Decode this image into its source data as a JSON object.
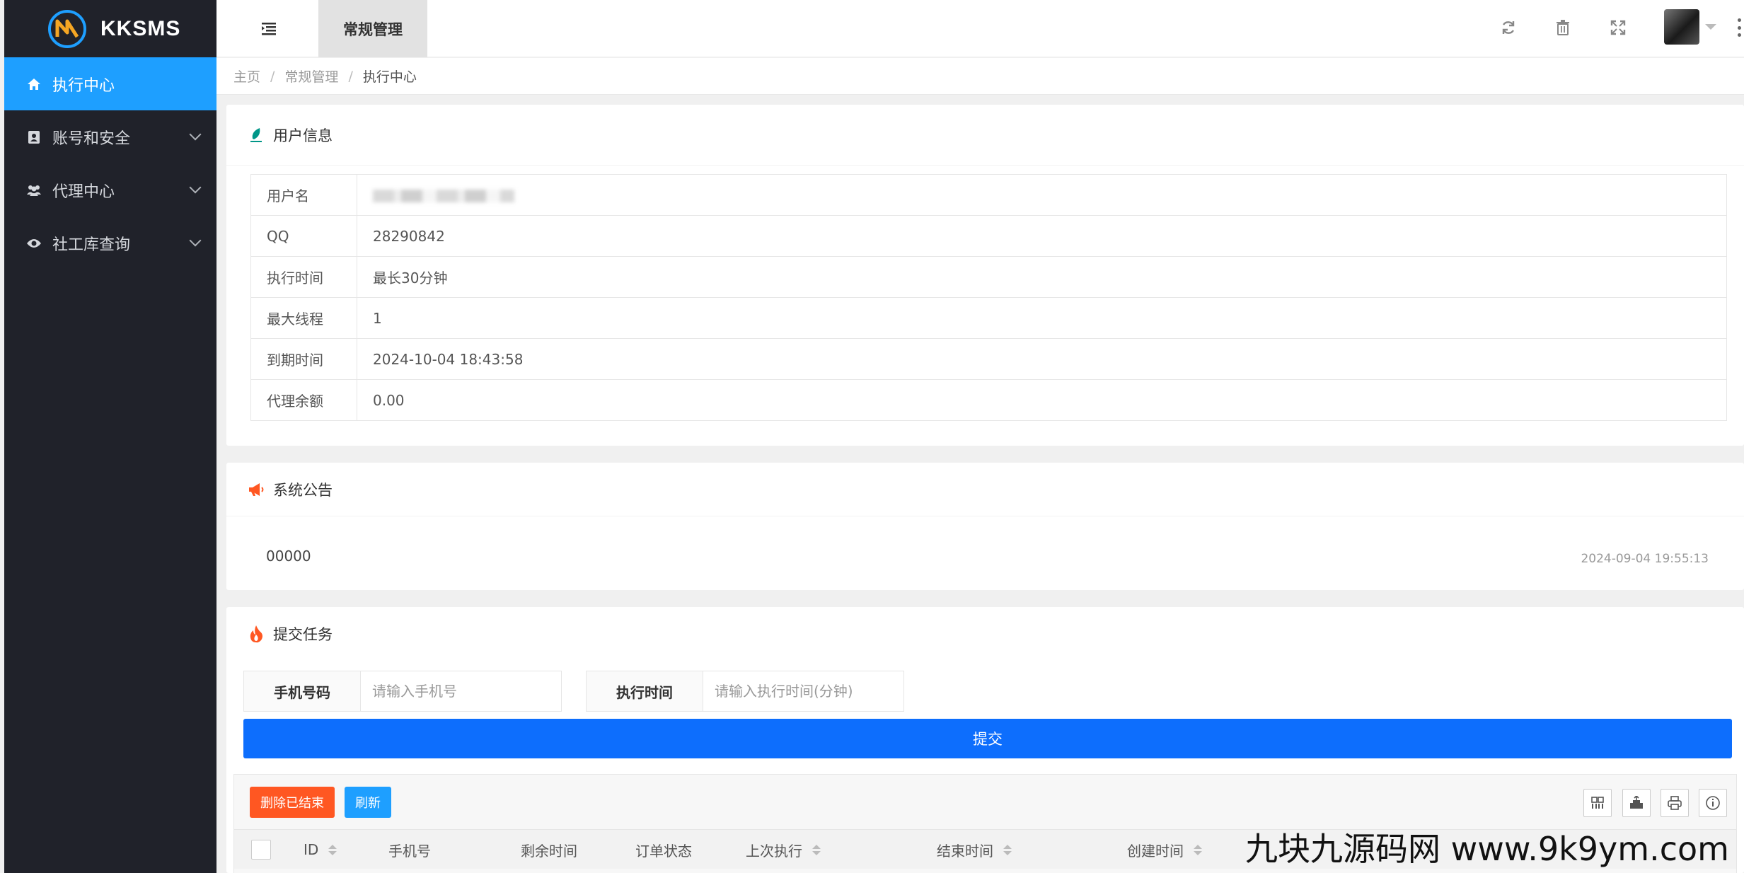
{
  "app": {
    "logo_text": "KKSMS"
  },
  "sidebar": {
    "items": [
      {
        "label": "执行中心",
        "icon": "home-icon",
        "active": true
      },
      {
        "label": "账号和安全",
        "icon": "address-book-icon"
      },
      {
        "label": "代理中心",
        "icon": "users-icon"
      },
      {
        "label": "社工库查询",
        "icon": "eye-icon"
      }
    ]
  },
  "header": {
    "active_tab": "常规管理",
    "icons": [
      "menu-icon",
      "refresh-icon",
      "trash-icon",
      "fullscreen-icon",
      "avatar",
      "more-icon"
    ]
  },
  "breadcrumb": {
    "items": [
      "主页",
      "常规管理",
      "执行中心"
    ]
  },
  "user_info": {
    "title": "用户信息",
    "rows": [
      {
        "key": "用户名",
        "value": ""
      },
      {
        "key": "QQ",
        "value": "28290842"
      },
      {
        "key": "执行时间",
        "value": "最长30分钟"
      },
      {
        "key": "最大线程",
        "value": "1"
      },
      {
        "key": "到期时间",
        "value": "2024-10-04 18:43:58"
      },
      {
        "key": "代理余额",
        "value": "0.00"
      }
    ]
  },
  "notice": {
    "title": "系统公告",
    "text": "00000",
    "time": "2024-09-04 19:55:13"
  },
  "task": {
    "title": "提交任务",
    "phone_label": "手机号码",
    "phone_placeholder": "请输入手机号",
    "time_label": "执行时间",
    "time_placeholder": "请输入执行时间(分钟)",
    "submit_label": "提交"
  },
  "table": {
    "delete_label": "删除已结束",
    "refresh_label": "刷新",
    "tools": [
      "columns-icon",
      "export-icon",
      "print-icon",
      "info-icon"
    ],
    "columns": [
      "ID",
      "手机号",
      "剩余时间",
      "订单状态",
      "上次执行",
      "结束时间",
      "创建时间"
    ]
  },
  "watermark": "九块九源码网 www.9k9ym.com",
  "colors": {
    "accent": "#1e9fff",
    "submit": "#0d6efd",
    "danger": "#ff5722",
    "sidebar": "#20222a"
  }
}
